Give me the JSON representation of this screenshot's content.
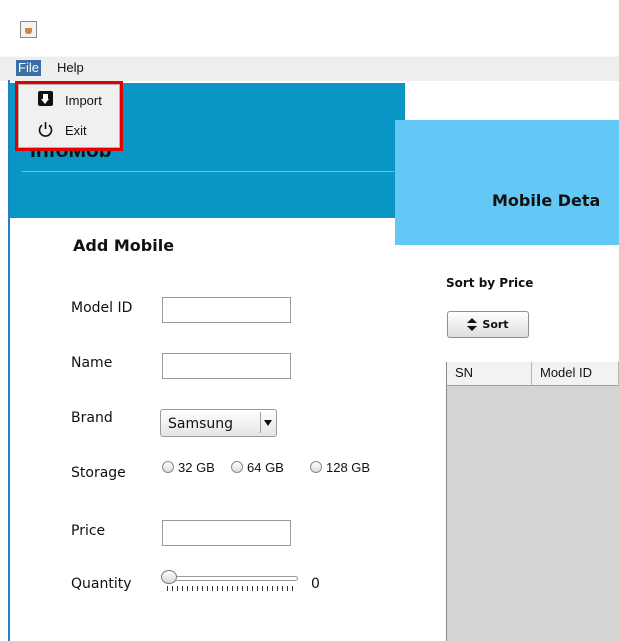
{
  "menubar": {
    "file": "File",
    "help": "Help"
  },
  "file_menu": {
    "items": [
      {
        "label": "Import",
        "icon": "import-icon"
      },
      {
        "label": "Exit",
        "icon": "power-icon"
      }
    ]
  },
  "header": {
    "app_title": "InfoMob",
    "panel_title": "Mobile Deta"
  },
  "form": {
    "heading": "Add Mobile",
    "model_id_label": "Model ID",
    "name_label": "Name",
    "brand_label": "Brand",
    "brand_selected": "Samsung",
    "storage_label": "Storage",
    "storage_options": [
      "32 GB",
      "64 GB",
      "128 GB"
    ],
    "price_label": "Price",
    "quantity_label": "Quantity",
    "quantity_value": "0"
  },
  "sort": {
    "heading": "Sort by Price",
    "button_label": "Sort",
    "button_icon": "sort-updown-icon"
  },
  "table": {
    "columns": [
      "SN",
      "Model ID"
    ]
  },
  "colors": {
    "banner_left": "#0a95c7",
    "banner_right": "#64c8f7",
    "highlight": "#e00000",
    "menu_selected": "#3a6ea5"
  }
}
